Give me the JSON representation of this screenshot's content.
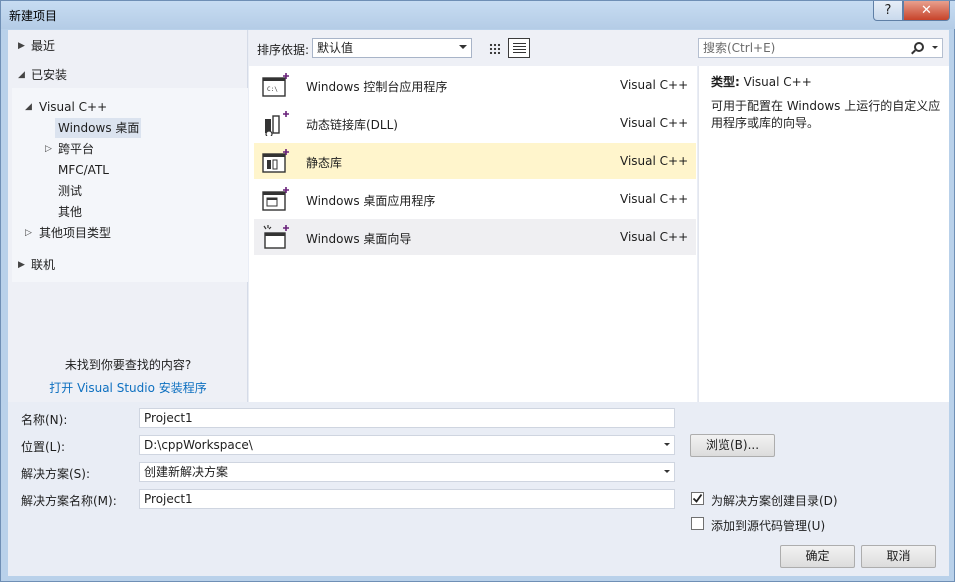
{
  "window": {
    "title": "新建项目",
    "help": "?",
    "close": "✕"
  },
  "left": {
    "recent": "最近",
    "installed": "已安装",
    "visual_cpp": "Visual C++",
    "windows_desktop": "Windows 桌面",
    "cross_platform": "跨平台",
    "mfc_atl": "MFC/ATL",
    "test": "测试",
    "other": "其他",
    "other_project_types": "其他项目类型",
    "online": "联机",
    "not_found": "未找到你要查找的内容?",
    "open_installer": "打开 Visual Studio 安装程序"
  },
  "toolbar": {
    "sort_label": "排序依据:",
    "sort_value": "默认值",
    "search_placeholder": "搜索(Ctrl+E)"
  },
  "templates": [
    {
      "name": "Windows 控制台应用程序",
      "lang": "Visual C++",
      "icon": "console-app-icon"
    },
    {
      "name": "动态链接库(DLL)",
      "lang": "Visual C++",
      "icon": "dll-icon"
    },
    {
      "name": "静态库",
      "lang": "Visual C++",
      "icon": "static-lib-icon"
    },
    {
      "name": "Windows 桌面应用程序",
      "lang": "Visual C++",
      "icon": "desktop-app-icon"
    },
    {
      "name": "Windows 桌面向导",
      "lang": "Visual C++",
      "icon": "desktop-wizard-icon"
    }
  ],
  "details": {
    "type_label": "类型:",
    "type_value": "Visual C++",
    "description": "可用于配置在 Windows 上运行的自定义应用程序或库的向导。"
  },
  "form": {
    "name_label": "名称(N):",
    "name_value": "Project1",
    "location_label": "位置(L):",
    "location_value": "D:\\cppWorkspace\\",
    "browse": "浏览(B)...",
    "solution_label": "解决方案(S):",
    "solution_value": "创建新解决方案",
    "solution_name_label": "解决方案名称(M):",
    "solution_name_value": "Project1",
    "create_dir_label": "为解决方案创建目录(D)",
    "create_dir_checked": true,
    "add_source_control_label": "添加到源代码管理(U)",
    "add_source_control_checked": false,
    "ok": "确定",
    "cancel": "取消"
  }
}
